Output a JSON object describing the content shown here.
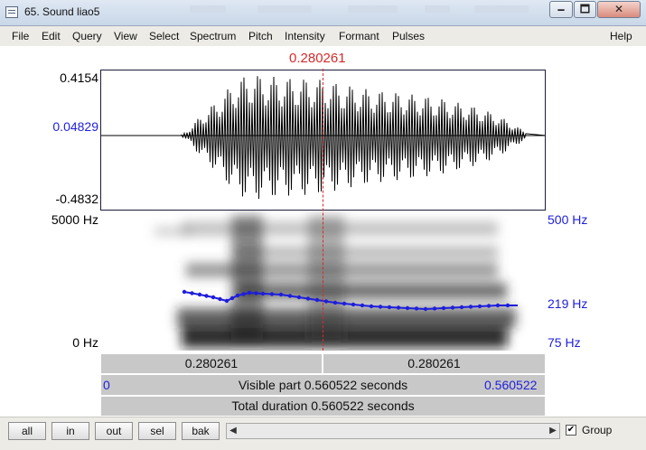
{
  "window": {
    "title": "65. Sound liao5",
    "minimize_glyph": "🗕",
    "maximize_glyph": "🗖",
    "close_glyph": "✕"
  },
  "menu": [
    "File",
    "Edit",
    "Query",
    "View",
    "Select",
    "Spectrum",
    "Pitch",
    "Intensity",
    "Formant",
    "Pulses"
  ],
  "help_label": "Help",
  "waveform": {
    "top_value": "0.4154",
    "mid_value": "0.04829",
    "bottom_value": "-0.4832"
  },
  "cursor": {
    "time": "0.280261",
    "color": "#d62a2a"
  },
  "spectrogram": {
    "top_freq": "5000 Hz",
    "bottom_freq": "0 Hz"
  },
  "pitch": {
    "top": "500 Hz",
    "current": "219 Hz",
    "bottom": "75 Hz",
    "color": "#1e1edc"
  },
  "time_bar": {
    "left_value": "0.280261",
    "right_value": "0.280261"
  },
  "visible_bar": {
    "start": "0",
    "label": "Visible part 0.560522 seconds",
    "end": "0.560522"
  },
  "total_bar": {
    "label": "Total duration 0.560522 seconds"
  },
  "buttons": {
    "all": "all",
    "in": "in",
    "out": "out",
    "sel": "sel",
    "bak": "bak"
  },
  "group": {
    "label": "Group",
    "checked": true,
    "check_glyph": "✔"
  }
}
